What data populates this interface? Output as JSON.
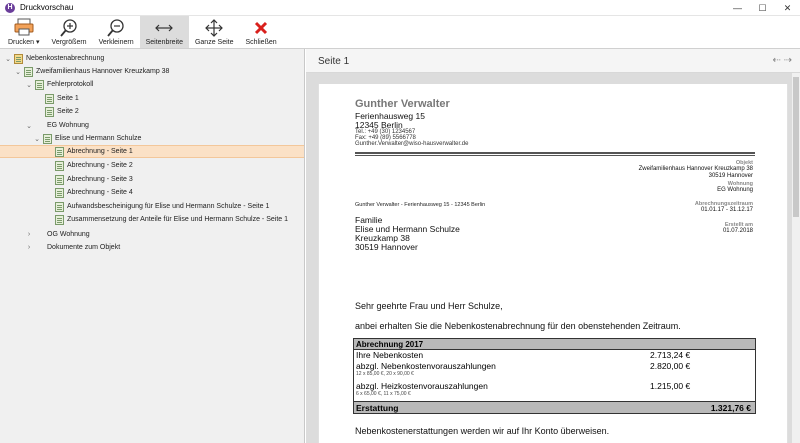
{
  "window": {
    "title": "Druckvorschau",
    "app_icon_letter": "H",
    "controls": {
      "minimize": "—",
      "maximize": "☐",
      "close": "✕"
    }
  },
  "toolbar": {
    "print_label": "Drucken",
    "zoom_in_label": "Vergrößern",
    "zoom_out_label": "Verkleinern",
    "page_width_label": "Seitenbreite",
    "whole_page_label": "Ganze Seite",
    "close_label": "Schließen"
  },
  "tree": {
    "items": [
      {
        "label": "Nebenkostenabrechnung"
      },
      {
        "label": "Zweifamilienhaus Hannover Kreuzkamp 38"
      },
      {
        "label": "Fehlerprotokoll"
      },
      {
        "label": "Seite 1"
      },
      {
        "label": "Seite 2"
      },
      {
        "label": "EG Wohnung"
      },
      {
        "label": "Elise und Hermann Schulze"
      },
      {
        "label": "Abrechnung - Seite 1"
      },
      {
        "label": "Abrechnung - Seite 2"
      },
      {
        "label": "Abrechnung - Seite 3"
      },
      {
        "label": "Abrechnung - Seite 4"
      },
      {
        "label": "Aufwandsbescheinigung für Elise und Hermann Schulze - Seite 1"
      },
      {
        "label": "Zusammensetzung der Anteile für Elise und Hermann Schulze - Seite 1"
      },
      {
        "label": "OG Wohnung"
      },
      {
        "label": "Dokumente zum Objekt"
      }
    ]
  },
  "preview": {
    "page_title": "Seite 1",
    "nav_back": "⇠",
    "nav_forward": "⇢"
  },
  "document": {
    "sender": {
      "name": "Gunther Verwalter",
      "street": "Ferienhausweg 15",
      "city": "12345 Berlin",
      "tel": "Tel.: +49 (30) 1234567",
      "fax": "Fax: +49 (89) 5566778",
      "email": "Gunther.Verwalter@wiso-hausverwalter.de"
    },
    "meta": {
      "object_label": "Objekt",
      "object_line1": "Zweifamilienhaus Hannover Kreuzkamp 38",
      "object_line2": "30519 Hannover",
      "unit_label": "Wohnung",
      "unit_value": "EG Wohnung",
      "period_label": "Abrechnungszeitraum",
      "period_value": "01.01.17 - 31.12.17",
      "created_label": "Erstellt am",
      "created_value": "01.07.2018"
    },
    "return_address": "Gunther Verwalter - Ferienhausweg 15 - 12345 Berlin",
    "recipient": {
      "line1": "Familie",
      "line2": "Elise und Hermann Schulze",
      "line3": "Kreuzkamp 38",
      "line4": "30519 Hannover"
    },
    "salutation": "Sehr geehrte Frau und Herr Schulze,",
    "intro": "anbei erhalten Sie die Nebenkostenabrechnung für den obenstehenden Zeitraum.",
    "table": {
      "header": "Abrechnung 2017",
      "row1_label": "Ihre Nebenkosten",
      "row1_amount": "2.713,24 €",
      "row2_label": "abzgl. Nebenkostenvorauszahlungen",
      "row2_amount": "2.820,00 €",
      "row2_sub": "12 x 85,00 €, 20 x 90,00 €",
      "row3_label": "abzgl. Heizkostenvorauszahlungen",
      "row3_amount": "1.215,00 €",
      "row3_sub": "6 x 65,00 €, 11 x 75,00 €",
      "total_label": "Erstattung",
      "total_amount": "1.321,76 €"
    },
    "closing": "Nebenkostenerstattungen werden wir auf Ihr Konto überweisen."
  }
}
